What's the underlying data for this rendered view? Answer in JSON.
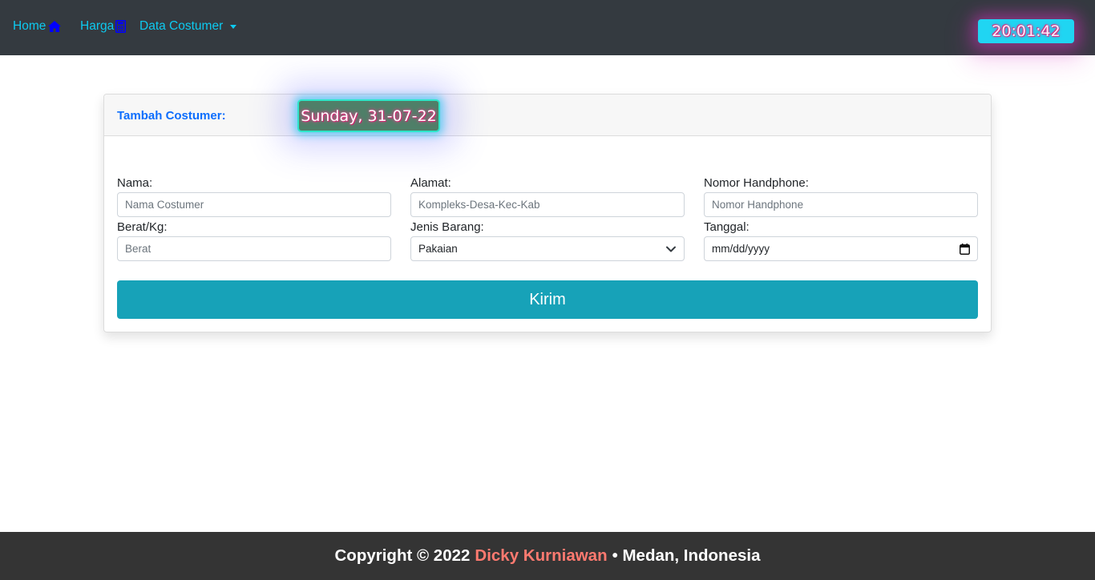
{
  "nav": {
    "home_label": "Home",
    "home_icon": "house-icon",
    "harga_label": "Harga",
    "harga_icon": "calculator-icon",
    "data_label": "Data Costumer",
    "clock": "20:01:42"
  },
  "card": {
    "title": "Tambah Costumer:",
    "date": "Sunday, 31-07-22"
  },
  "form": {
    "nama_label": "Nama:",
    "nama_placeholder": "Nama Costumer",
    "alamat_label": "Alamat:",
    "alamat_placeholder": "Kompleks-Desa-Kec-Kab",
    "hp_label": "Nomor Handphone:",
    "hp_placeholder": "Nomor Handphone",
    "berat_label": "Berat/Kg:",
    "berat_placeholder": "Berat",
    "jenis_label": "Jenis Barang:",
    "jenis_value": "Pakaian",
    "tanggal_label": "Tanggal:",
    "tanggal_placeholder": "mm/dd/yyyy",
    "submit_label": "Kirim"
  },
  "footer": {
    "prefix": "Copyright © 2022",
    "author": "Dicky Kurniawan",
    "suffix": "• Medan, Indonesia"
  },
  "colors": {
    "navbar": "#343a40",
    "nav_text": "#0dcaf0",
    "primary": "#0d6efd",
    "submit": "#17a2b8",
    "footer": "#343434",
    "author": "#ff7a70"
  }
}
